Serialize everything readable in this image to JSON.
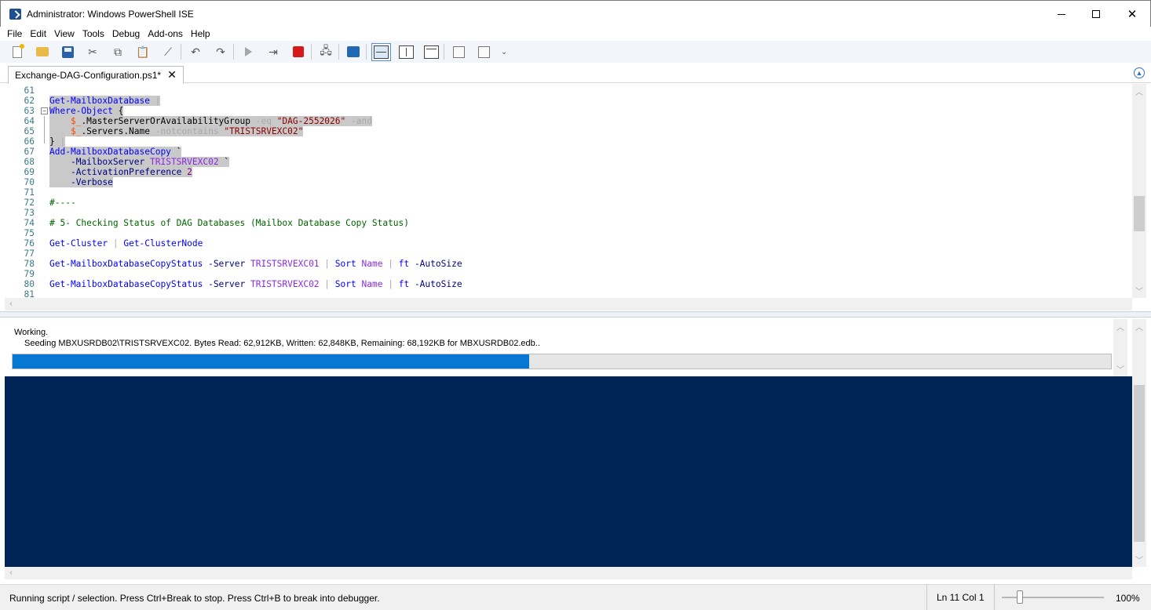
{
  "window": {
    "title": "Administrator: Windows PowerShell ISE",
    "minimize": "—",
    "maximize": "☐",
    "close": "✕"
  },
  "menu": [
    "File",
    "Edit",
    "View",
    "Tools",
    "Debug",
    "Add-ons",
    "Help"
  ],
  "toolbar": {
    "icons": [
      "new-script-icon",
      "open-icon",
      "save-icon",
      "cut-icon",
      "copy-icon",
      "paste-icon",
      "clear-console-icon",
      "undo-icon",
      "redo-icon",
      "run-script-icon",
      "run-selection-icon",
      "stop-icon",
      "remote-powershell-icon",
      "powershell-icon",
      "script-pane-top-icon",
      "script-pane-right-icon",
      "script-pane-maximized-icon",
      "show-command-icon",
      "show-addon-icon"
    ]
  },
  "tab": {
    "label": "Exchange-DAG-Configuration.ps1*",
    "close": "✕"
  },
  "editor": {
    "lines": [
      {
        "n": "61",
        "parts": []
      },
      {
        "n": "62",
        "parts": [
          [
            "c-cmd",
            "Get-MailboxDatabase"
          ],
          [
            "c-txt",
            " "
          ],
          [
            "c-op",
            "|"
          ]
        ],
        "hl": true
      },
      {
        "n": "63",
        "parts": [
          [
            "c-cmd",
            "Where-Object"
          ],
          [
            "c-txt",
            " {"
          ]
        ],
        "hl": true,
        "fold": "−"
      },
      {
        "n": "64",
        "parts": [
          [
            "c-txt",
            "    "
          ],
          [
            "c-var",
            "$_"
          ],
          [
            "c-prop",
            ".MasterServerOrAvailabilityGroup "
          ],
          [
            "c-op",
            "-eq"
          ],
          [
            "c-txt",
            " "
          ],
          [
            "c-str",
            "\"DAG-2552026\""
          ],
          [
            "c-txt",
            " "
          ],
          [
            "c-op",
            "-and"
          ]
        ],
        "hl": true
      },
      {
        "n": "65",
        "parts": [
          [
            "c-txt",
            "    "
          ],
          [
            "c-var",
            "$_"
          ],
          [
            "c-prop",
            ".Servers.Name "
          ],
          [
            "c-op",
            "-notcontains"
          ],
          [
            "c-txt",
            " "
          ],
          [
            "c-str",
            "\"TRISTSRVEXC02\""
          ]
        ],
        "hl": true
      },
      {
        "n": "66",
        "parts": [
          [
            "c-txt",
            "} "
          ],
          [
            "c-op",
            "|"
          ]
        ],
        "hl": true
      },
      {
        "n": "67",
        "parts": [
          [
            "c-cmd",
            "Add-MailboxDatabaseCopy"
          ],
          [
            "c-txt",
            " `"
          ]
        ],
        "hl": true
      },
      {
        "n": "68",
        "parts": [
          [
            "c-txt",
            "    "
          ],
          [
            "c-param",
            "-MailboxServer"
          ],
          [
            "c-txt",
            " "
          ],
          [
            "c-arg",
            "TRISTSRVEXC02"
          ],
          [
            "c-txt",
            " `"
          ]
        ],
        "hl": true
      },
      {
        "n": "69",
        "parts": [
          [
            "c-txt",
            "    "
          ],
          [
            "c-param",
            "-ActivationPreference"
          ],
          [
            "c-txt",
            " "
          ],
          [
            "c-num",
            "2"
          ]
        ],
        "hl": true
      },
      {
        "n": "70",
        "parts": [
          [
            "c-txt",
            "    "
          ],
          [
            "c-param",
            "-Verbose"
          ]
        ],
        "hl": true
      },
      {
        "n": "71",
        "parts": []
      },
      {
        "n": "72",
        "parts": [
          [
            "c-cmt",
            "#----"
          ]
        ]
      },
      {
        "n": "73",
        "parts": []
      },
      {
        "n": "74",
        "parts": [
          [
            "c-cmt",
            "# 5- Checking Status of DAG Databases (Mailbox Database Copy Status)"
          ]
        ]
      },
      {
        "n": "75",
        "parts": []
      },
      {
        "n": "76",
        "parts": [
          [
            "c-cmd",
            "Get-Cluster"
          ],
          [
            "c-txt",
            " "
          ],
          [
            "c-op",
            "|"
          ],
          [
            "c-txt",
            " "
          ],
          [
            "c-cmd",
            "Get-ClusterNode"
          ]
        ]
      },
      {
        "n": "77",
        "parts": []
      },
      {
        "n": "78",
        "parts": [
          [
            "c-cmd",
            "Get-MailboxDatabaseCopyStatus"
          ],
          [
            "c-txt",
            " "
          ],
          [
            "c-param",
            "-Server"
          ],
          [
            "c-txt",
            " "
          ],
          [
            "c-arg",
            "TRISTSRVEXC01"
          ],
          [
            "c-txt",
            " "
          ],
          [
            "c-op",
            "|"
          ],
          [
            "c-txt",
            " "
          ],
          [
            "c-cmd",
            "Sort"
          ],
          [
            "c-txt",
            " "
          ],
          [
            "c-arg",
            "Name"
          ],
          [
            "c-txt",
            " "
          ],
          [
            "c-op",
            "|"
          ],
          [
            "c-txt",
            " "
          ],
          [
            "c-cmd",
            "ft"
          ],
          [
            "c-txt",
            " "
          ],
          [
            "c-param",
            "-AutoSize"
          ]
        ]
      },
      {
        "n": "79",
        "parts": []
      },
      {
        "n": "80",
        "parts": [
          [
            "c-cmd",
            "Get-MailboxDatabaseCopyStatus"
          ],
          [
            "c-txt",
            " "
          ],
          [
            "c-param",
            "-Server"
          ],
          [
            "c-txt",
            " "
          ],
          [
            "c-arg",
            "TRISTSRVEXC02"
          ],
          [
            "c-txt",
            " "
          ],
          [
            "c-op",
            "|"
          ],
          [
            "c-txt",
            " "
          ],
          [
            "c-cmd",
            "Sort"
          ],
          [
            "c-txt",
            " "
          ],
          [
            "c-arg",
            "Name"
          ],
          [
            "c-txt",
            " "
          ],
          [
            "c-op",
            "|"
          ],
          [
            "c-txt",
            " "
          ],
          [
            "c-cmd",
            "ft"
          ],
          [
            "c-txt",
            " "
          ],
          [
            "c-param",
            "-AutoSize"
          ]
        ]
      },
      {
        "n": "81",
        "parts": []
      }
    ]
  },
  "console": {
    "progress_title": "Working.",
    "progress_status": "Seeding MBXUSRDB02\\TRISTSRVEXC02. Bytes Read: 62,912KB, Written: 62,848KB, Remaining: 68,192KB for MBXUSRDB02.edb..",
    "progress_fraction": 0.47
  },
  "status": {
    "message": "Running script / selection.  Press Ctrl+Break to stop.  Press Ctrl+B to break into debugger.",
    "position": "Ln 11  Col 1",
    "zoom": "100%",
    "zoom_fraction": 0.18
  }
}
